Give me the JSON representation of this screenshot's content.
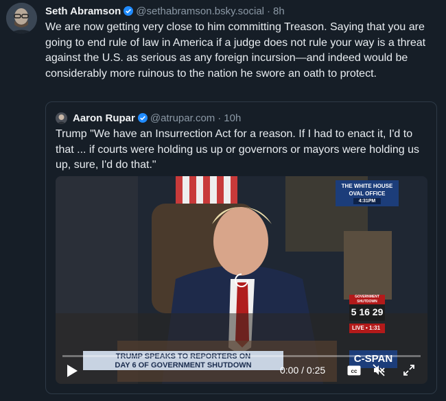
{
  "post": {
    "author_name": "Seth Abramson",
    "handle": "@sethabramson.bsky.social",
    "separator": "·",
    "time": "8h",
    "text": "We are now getting very close to him committing Treason. Saying that you are going to end rule of law in America if a judge does not rule your way is a threat against the U.S. as serious as any foreign incursion—and indeed would be considerably more ruinous to the nation he swore an oath to protect."
  },
  "quote": {
    "author_name": "Aaron Rupar",
    "handle": "@atrupar.com",
    "separator": "·",
    "time": "10h",
    "text": "Trump \"We have an Insurrection Act for a reason. If I had to enact it, I'd to that ... if courts were holding us up or governors or mayors were holding us up, sure, I'd do that.\""
  },
  "video": {
    "location_line1": "THE WHITE HOUSE",
    "location_line2": "OVAL OFFICE",
    "local_time": "4:31PM",
    "chyron_line1": "TRUMP SPEAKS TO REPORTERS ON",
    "chyron_line2": "DAY 6 OF GOVERNMENT SHUTDOWN",
    "shutdown_label": "GOVERNMENT SHUTDOWN",
    "shutdown_counter": "5 16 29",
    "live_label": "LIVE •",
    "live_time": "1:31",
    "network": "C-SPAN",
    "time_display": "0:00 / 0:25",
    "progress": 0.0,
    "cc_label": "cc"
  },
  "colors": {
    "background": "#161e27",
    "verified": "#208bfe",
    "muted_text": "#8b98a5",
    "quote_border": "#2e3a47"
  }
}
